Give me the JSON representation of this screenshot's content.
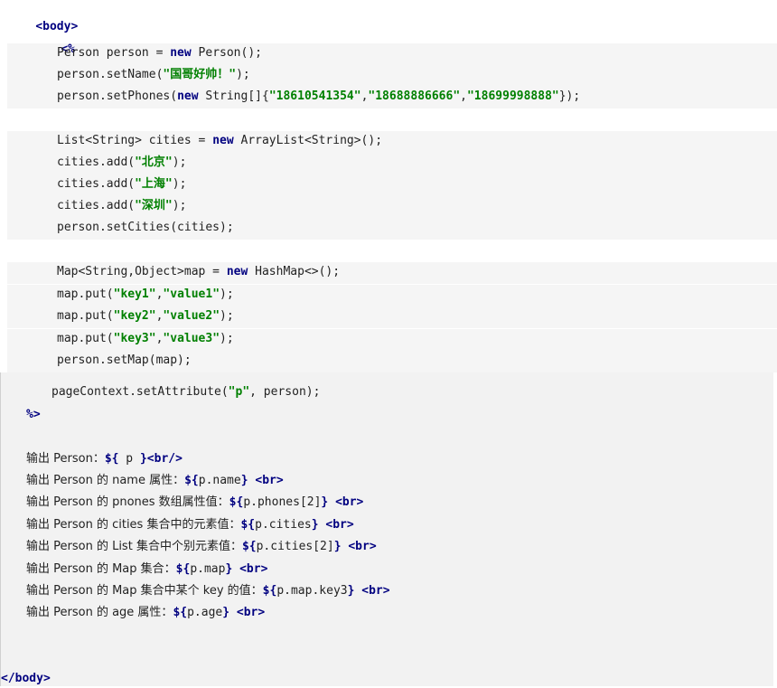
{
  "code": {
    "body_open": "<body>",
    "scriptlet_open": "<%",
    "l1": [
      "Person person = ",
      "new",
      " Person();"
    ],
    "l2": [
      "person.setName(",
      "\"国哥好帅！\"",
      ");"
    ],
    "l3": [
      "person.setPhones(",
      "new",
      " String[]{",
      "\"18610541354\"",
      ",",
      "\"18688886666\"",
      ",",
      "\"18699998888\"",
      "});"
    ],
    "l4": [
      "List<String> cities = ",
      "new",
      " ArrayList<String>();"
    ],
    "l5": [
      "cities.add(",
      "\"北京\"",
      ");"
    ],
    "l6": [
      "cities.add(",
      "\"上海\"",
      ");"
    ],
    "l7": [
      "cities.add(",
      "\"深圳\"",
      ");"
    ],
    "l8": "person.setCities(cities);",
    "l9": [
      "Map<String,Object>map = ",
      "new",
      " HashMap<>();"
    ],
    "l10": [
      "map.put(",
      "\"key1\"",
      ",",
      "\"value1\"",
      ");"
    ],
    "l11": [
      "map.put(",
      "\"key2\"",
      ",",
      "\"value2\"",
      ");"
    ],
    "l12": [
      "map.put(",
      "\"key3\"",
      ",",
      "\"value3\"",
      ");"
    ],
    "l13": "person.setMap(map);",
    "l14": [
      "pageContext.setAttribute(",
      "\"p\"",
      ", person);"
    ],
    "scriptlet_close": "%>",
    "body_close": "</body>"
  },
  "output": [
    {
      "text": "输出 Person：",
      "el_open": "${",
      "el_expr": " p ",
      "el_close": "}",
      "tail": "<br/>"
    },
    {
      "text": "输出 Person 的 name 属性：",
      "el_open": "${",
      "el_expr": "p.name",
      "el_close": "}",
      "tail": " <br>"
    },
    {
      "text": "输出 Person 的 pnones 数组属性值：",
      "el_open": "${",
      "el_expr": "p.phones[2]",
      "el_close": "}",
      "tail": " <br>"
    },
    {
      "text": "输出 Person 的 cities 集合中的元素值：",
      "el_open": "${",
      "el_expr": "p.cities",
      "el_close": "}",
      "tail": " <br>"
    },
    {
      "text": "输出 Person 的 List 集合中个别元素值：",
      "el_open": "${",
      "el_expr": "p.cities[2]",
      "el_close": "}",
      "tail": " <br>"
    },
    {
      "text": "输出 Person 的 Map 集合：",
      "el_open": "${",
      "el_expr": "p.map",
      "el_close": "}",
      "tail": " <br>"
    },
    {
      "text": "输出 Person 的 Map 集合中某个 key 的值：",
      "el_open": "${",
      "el_expr": "p.map.key3",
      "el_close": "}",
      "tail": " <br>"
    },
    {
      "text": "输出 Person 的 age 属性：",
      "el_open": "${",
      "el_expr": "p.age",
      "el_close": "}",
      "tail": " <br>"
    }
  ]
}
